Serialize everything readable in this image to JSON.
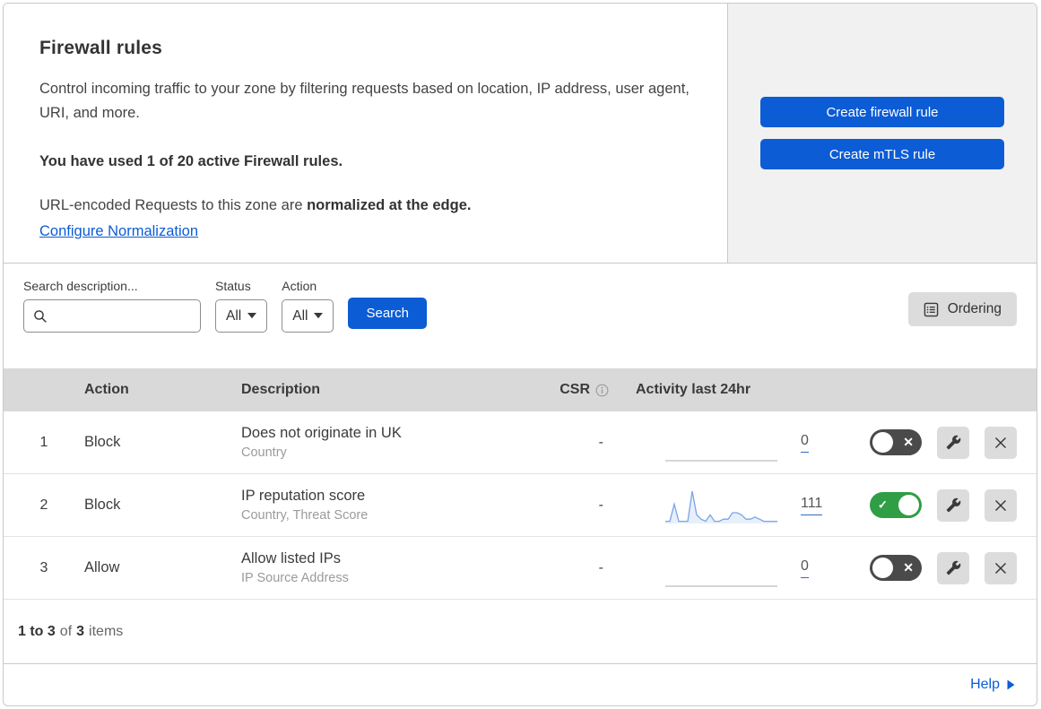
{
  "header": {
    "title": "Firewall rules",
    "description": "Control incoming traffic to your zone by filtering requests based on location, IP address, user agent, URI, and more.",
    "usage": "You have used 1 of 20 active Firewall rules.",
    "normalization_prefix": "URL-encoded Requests to this zone are ",
    "normalization_bold": "normalized at the edge.",
    "normalization_link": "Configure Normalization"
  },
  "actions_panel": {
    "create_firewall_rule": "Create firewall rule",
    "create_mtls_rule": "Create mTLS rule"
  },
  "filters": {
    "search_label": "Search description...",
    "status_label": "Status",
    "status_value": "All",
    "action_label": "Action",
    "action_value": "All",
    "search_button": "Search",
    "ordering_button": "Ordering"
  },
  "table": {
    "columns": {
      "action": "Action",
      "description": "Description",
      "csr": "CSR",
      "activity": "Activity last 24hr"
    },
    "rows": [
      {
        "priority": "1",
        "action": "Block",
        "description": "Does not originate in UK",
        "fields": "Country",
        "csr": "-",
        "activity_count": "0",
        "enabled": false,
        "sparkline": [
          0,
          0,
          0,
          0,
          0,
          0,
          0,
          0,
          0,
          0,
          0,
          0,
          0,
          0,
          0,
          0,
          0,
          0,
          0,
          0
        ]
      },
      {
        "priority": "2",
        "action": "Block",
        "description": "IP reputation score",
        "fields": "Country, Threat Score",
        "csr": "-",
        "activity_count": "111",
        "enabled": true,
        "sparkline": [
          1,
          1,
          9,
          1,
          1,
          1,
          15,
          4,
          2,
          1,
          4,
          1,
          1,
          2,
          2,
          5,
          5,
          4,
          2,
          2,
          3,
          2,
          1,
          1,
          1,
          1
        ]
      },
      {
        "priority": "3",
        "action": "Allow",
        "description": "Allow listed IPs",
        "fields": "IP Source Address",
        "csr": "-",
        "activity_count": "0",
        "enabled": false,
        "sparkline": [
          0,
          0,
          0,
          0,
          0,
          0,
          0,
          0,
          0,
          0,
          0,
          0,
          0,
          0,
          0,
          0,
          0,
          0,
          0,
          0
        ]
      }
    ],
    "summary": {
      "range": "1 to 3",
      "of": "of",
      "total": "3",
      "items": "items"
    }
  },
  "footer": {
    "help": "Help"
  },
  "toggle": {
    "on_glyph": "✓",
    "off_glyph": "✕"
  },
  "colors": {
    "accent_blue": "#0b5cd5",
    "toggle_on_green": "#2f9e44",
    "toggle_off_gray": "#4a4a4a",
    "sparkline_blue": "#7aa5e6",
    "header_row_gray": "#d9d9d9",
    "panel_gray": "#f1f1f1"
  },
  "chart_data": {
    "type": "line",
    "title": "Activity last 24hr sparkline (rule 2)",
    "x": [
      0,
      1,
      2,
      3,
      4,
      5,
      6,
      7,
      8,
      9,
      10,
      11,
      12,
      13,
      14,
      15,
      16,
      17,
      18,
      19,
      20,
      21,
      22,
      23,
      24,
      25
    ],
    "values": [
      1,
      1,
      9,
      1,
      1,
      1,
      15,
      4,
      2,
      1,
      4,
      1,
      1,
      2,
      2,
      5,
      5,
      4,
      2,
      2,
      3,
      2,
      1,
      1,
      1,
      1
    ],
    "total": 111,
    "xlabel": "",
    "ylabel": "",
    "legend": false,
    "grid": false
  }
}
